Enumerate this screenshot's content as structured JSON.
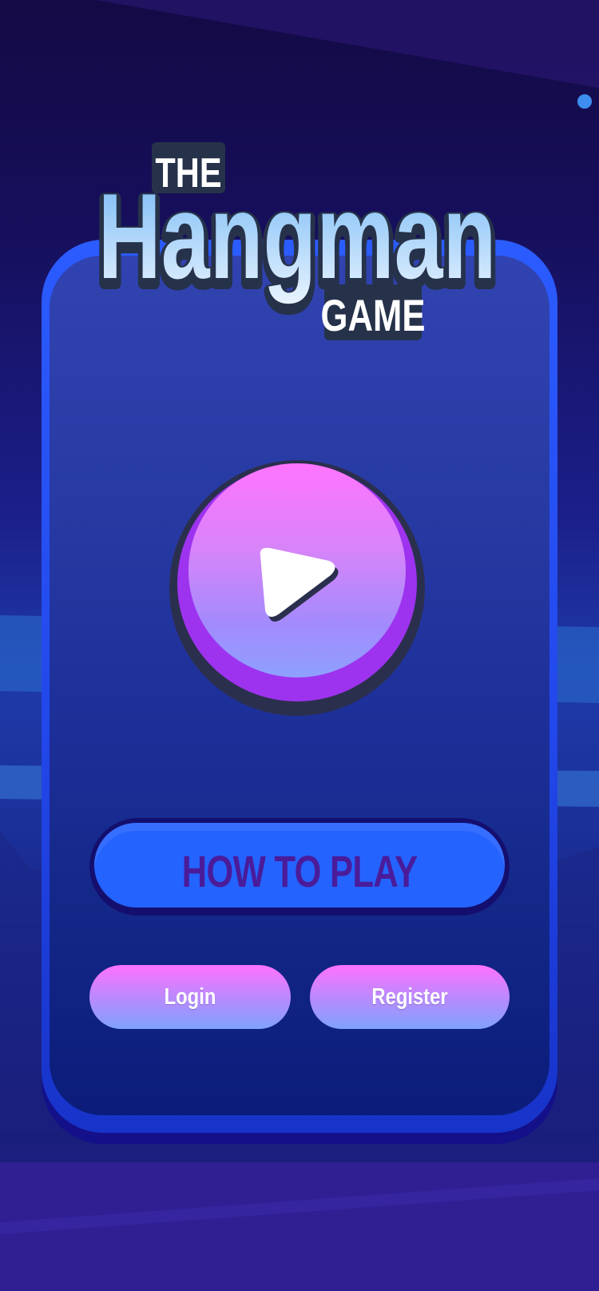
{
  "title": {
    "line1": "THE",
    "line2": "Hangman",
    "line3": "GAME"
  },
  "play_button": {
    "icon": "play-icon"
  },
  "buttons": {
    "how_to_play": "HOW TO PLAY",
    "login": "Login",
    "register": "Register"
  },
  "colors": {
    "panel_blue": "#2247ea",
    "play_pink": "#ff74ff",
    "play_purple": "#9d33ef",
    "how_to_play_face": "#2563ff",
    "how_to_play_text": "#4a1c9a",
    "logo_light_blue": "#8fc9ff",
    "logo_outline": "#26324a"
  }
}
